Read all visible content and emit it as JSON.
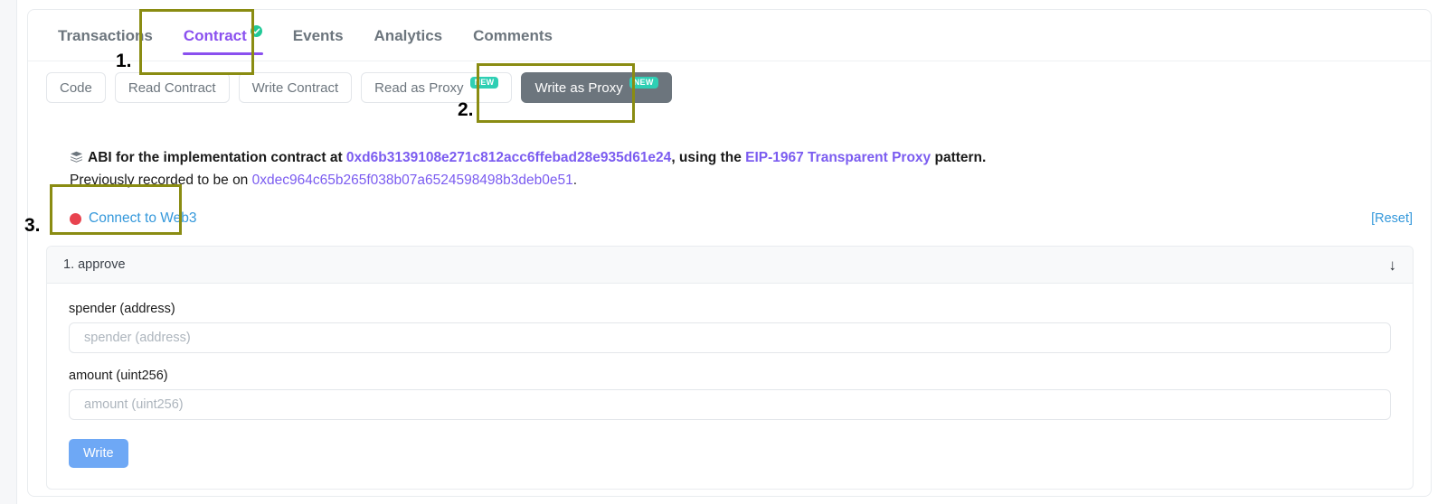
{
  "tabs": [
    {
      "label": "Transactions",
      "active": false,
      "verified": false
    },
    {
      "label": "Contract",
      "active": true,
      "verified": true
    },
    {
      "label": "Events",
      "active": false,
      "verified": false
    },
    {
      "label": "Analytics",
      "active": false,
      "verified": false
    },
    {
      "label": "Comments",
      "active": false,
      "verified": false
    }
  ],
  "sub_buttons": [
    {
      "label": "Code",
      "badge": "",
      "active": false
    },
    {
      "label": "Read Contract",
      "badge": "",
      "active": false
    },
    {
      "label": "Write Contract",
      "badge": "",
      "active": false
    },
    {
      "label": "Read as Proxy",
      "badge": "NEW",
      "active": false
    },
    {
      "label": "Write as Proxy",
      "badge": "NEW",
      "active": true
    }
  ],
  "abi_notice": {
    "icon": "stack-icon",
    "line1_prefix": "ABI for the implementation contract at ",
    "implementation_address": "0xd6b3139108e271c812acc6ffebad28e935d61e24",
    "line1_middle": ", using the ",
    "proxy_pattern_link": "EIP-1967 Transparent Proxy",
    "line1_suffix": " pattern.",
    "line2_prefix": "Previously recorded to be on ",
    "previous_address": "0xdec964c65b265f038b07a6524598498b3deb0e51",
    "line2_suffix": "."
  },
  "connect": {
    "status_dot_color": "#e8434f",
    "label": "Connect to Web3",
    "reset_label": "[Reset]"
  },
  "accordion": {
    "title": "1. approve",
    "arrow": "↓",
    "fields": [
      {
        "label": "spender (address)",
        "placeholder": "spender (address)",
        "value": ""
      },
      {
        "label": "amount (uint256)",
        "placeholder": "amount (uint256)",
        "value": ""
      }
    ],
    "submit_label": "Write"
  },
  "annotations": [
    {
      "number": "1.",
      "target": "contract-tab"
    },
    {
      "number": "2.",
      "target": "write-as-proxy-button"
    },
    {
      "number": "3.",
      "target": "connect-to-web3-link"
    }
  ],
  "colors": {
    "accent_purple": "#8a50ef",
    "badge_teal": "#2ecfb4",
    "link_blue": "#3498db",
    "write_button_blue": "#6ea8f5",
    "annotation_olive": "#8a8c12",
    "status_red": "#e8434f"
  }
}
